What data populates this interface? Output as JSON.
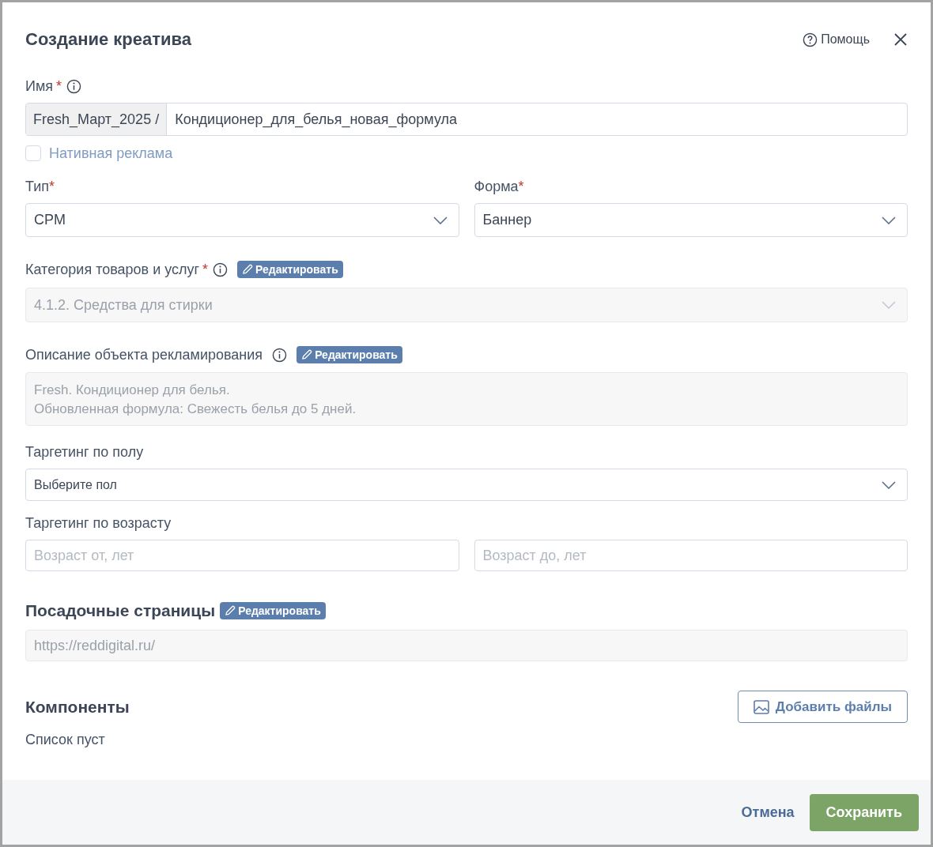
{
  "dialog": {
    "title": "Создание креатива",
    "help": "Помощь"
  },
  "name_field": {
    "label": "Имя",
    "required_mark": "*",
    "info": true,
    "prefix": "Fresh_Март_2025 /",
    "value": "Кондиционер_для_белья_новая_формула"
  },
  "native_ad": {
    "label": "Нативная реклама",
    "checked": false
  },
  "type_field": {
    "label": "Тип",
    "required_mark": "*",
    "value": "CPM"
  },
  "form_field": {
    "label": "Форма",
    "required_mark": "*",
    "value": "Баннер"
  },
  "category": {
    "label": "Категория товаров и услуг",
    "required_mark": "*",
    "info": true,
    "edit_button": "Редактировать",
    "value": "4.1.2. Средства для стирки",
    "disabled": true
  },
  "description": {
    "label": "Описание объекта рекламирования",
    "info": true,
    "edit_button": "Редактировать",
    "value": "Fresh. Кондиционер для белья.\nОбновленная формула: Свежесть белья до 5 дней.",
    "disabled": true
  },
  "gender": {
    "label": "Таргетинг по полу",
    "value": "Выберите пол"
  },
  "age": {
    "label": "Таргетинг по возрасту",
    "from_placeholder": "Возраст от, лет",
    "to_placeholder": "Возраст до, лет"
  },
  "landing": {
    "title": "Посадочные страницы",
    "edit_button": "Редактировать",
    "value": "https://reddigital.ru/",
    "disabled": true
  },
  "components": {
    "title": "Компоненты",
    "add_button": "Добавить файлы",
    "empty_text": "Список пуст"
  },
  "footer": {
    "cancel": "Отмена",
    "save": "Сохранить"
  }
}
